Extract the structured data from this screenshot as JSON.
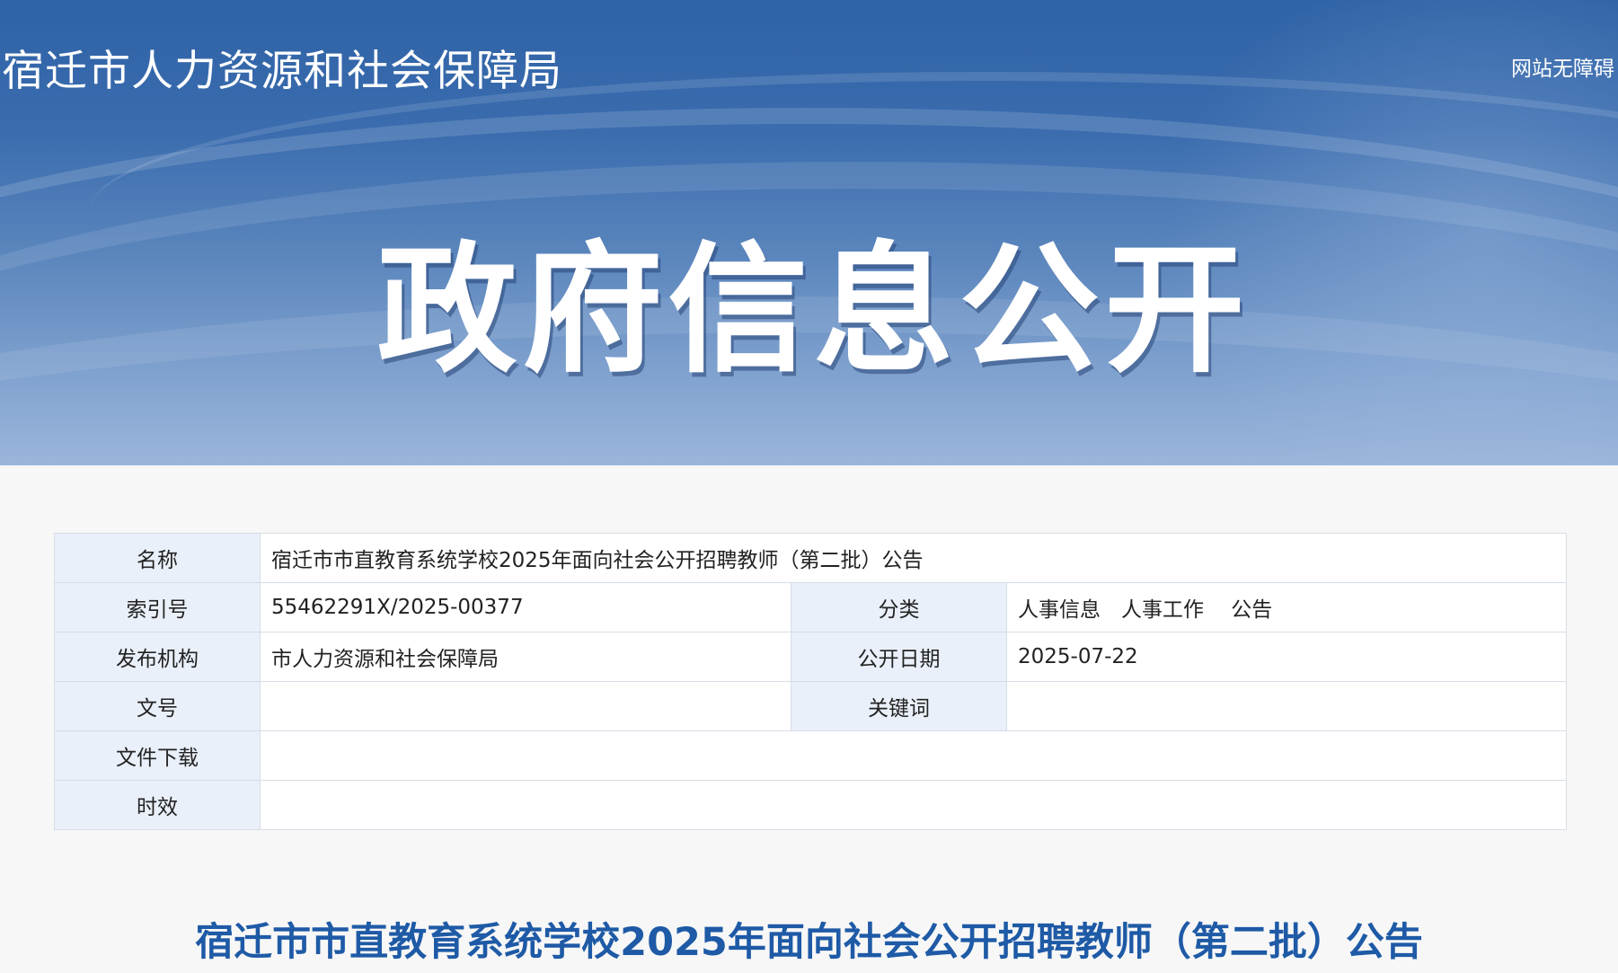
{
  "header": {
    "site_title": "宿迁市人力资源和社会保障局",
    "accessibility_link": "网站无障碍",
    "banner_heading": "政府信息公开"
  },
  "info_table": {
    "name_label": "名称",
    "name_value": "宿迁市市直教育系统学校2025年面向社会公开招聘教师（第二批）公告",
    "index_label": "索引号",
    "index_value": "55462291X/2025-00377",
    "category_label": "分类",
    "category_value": "人事信息　人事工作　 公告",
    "publisher_label": "发布机构",
    "publisher_value": "市人力资源和社会保障局",
    "date_label": "公开日期",
    "date_value": "2025-07-22",
    "doc_no_label": "文号",
    "doc_no_value": "",
    "keywords_label": "关键词",
    "keywords_value": "",
    "download_label": "文件下载",
    "download_value": "",
    "validity_label": "时效",
    "validity_value": ""
  },
  "article": {
    "title": "宿迁市市直教育系统学校2025年面向社会公开招聘教师（第二批）公告"
  },
  "colors": {
    "banner_blue": "#2f63a6",
    "label_bg": "#eaf0f9",
    "title_blue": "#1e5aa6"
  }
}
